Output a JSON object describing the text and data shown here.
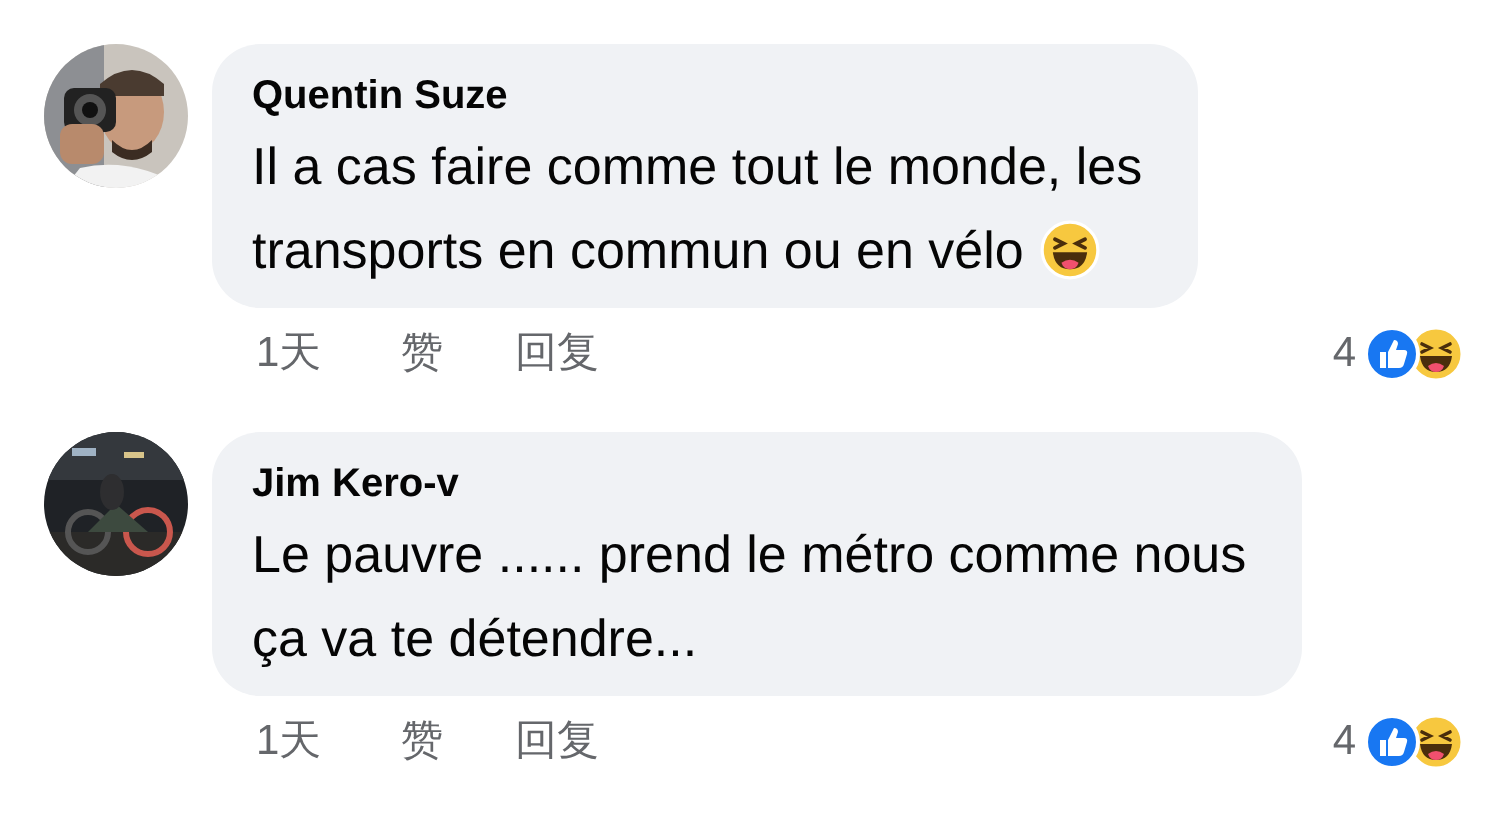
{
  "comments": [
    {
      "author": "Quentin Suze",
      "lines": [
        "Il a cas faire comme tout le monde, les",
        "transports en commun ou en vélo"
      ],
      "ends_with_emoji": true,
      "time": "1天",
      "like": "赞",
      "reply": "回复",
      "reaction_count": "4"
    },
    {
      "author": "Jim Kero-v",
      "lines": [
        "Le pauvre ...... prend le métro comme nous",
        "ça va te détendre..."
      ],
      "ends_with_emoji": false,
      "time": "1天",
      "like": "赞",
      "reply": "回复",
      "reaction_count": "4"
    }
  ]
}
